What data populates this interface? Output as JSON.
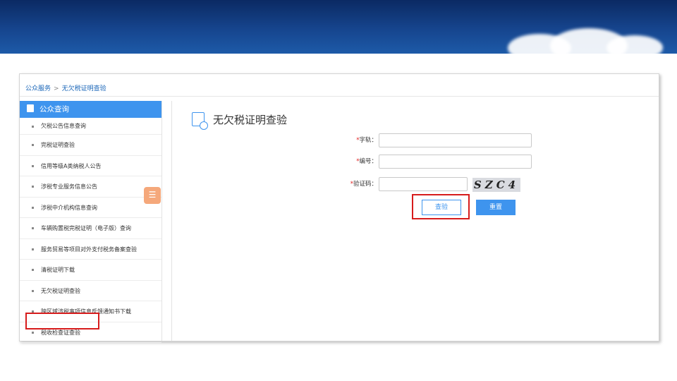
{
  "breadcrumb": {
    "root": "公众服务",
    "separator": ">",
    "current": "无欠税证明查验"
  },
  "sidebar": {
    "header": "公众查询",
    "items": [
      {
        "label": "欠税公告信息查询"
      },
      {
        "label": "完税证明查验"
      },
      {
        "label": "信用等级A类纳税人公告"
      },
      {
        "label": "涉税专业服务信息公告"
      },
      {
        "label": "涉税中介机构信息查询"
      },
      {
        "label": "车辆购置税完税证明（电子版）查询"
      },
      {
        "label": "服务贸易等项目对外支付税务备案查验"
      },
      {
        "label": "清税证明下载"
      },
      {
        "label": "无欠税证明查验"
      },
      {
        "label": "跨区域涉税事项信息反馈通知书下载"
      },
      {
        "label": "税收检查证查验"
      }
    ]
  },
  "main": {
    "title": "无欠税证明查验",
    "form": {
      "zigui_label": "字轨：",
      "bianhao_label": "编号：",
      "captcha_label": "验证码：",
      "required_mark": "*",
      "captcha_text": "SZC4"
    },
    "buttons": {
      "query": "查验",
      "reset": "重置"
    }
  },
  "colors": {
    "accent": "#3e94ee",
    "highlight": "#d71c1c",
    "toggle": "#f5a87b"
  },
  "icons": {
    "sidebar_header": "document-icon",
    "title": "clock-document-icon",
    "toggle": "menu-icon"
  }
}
